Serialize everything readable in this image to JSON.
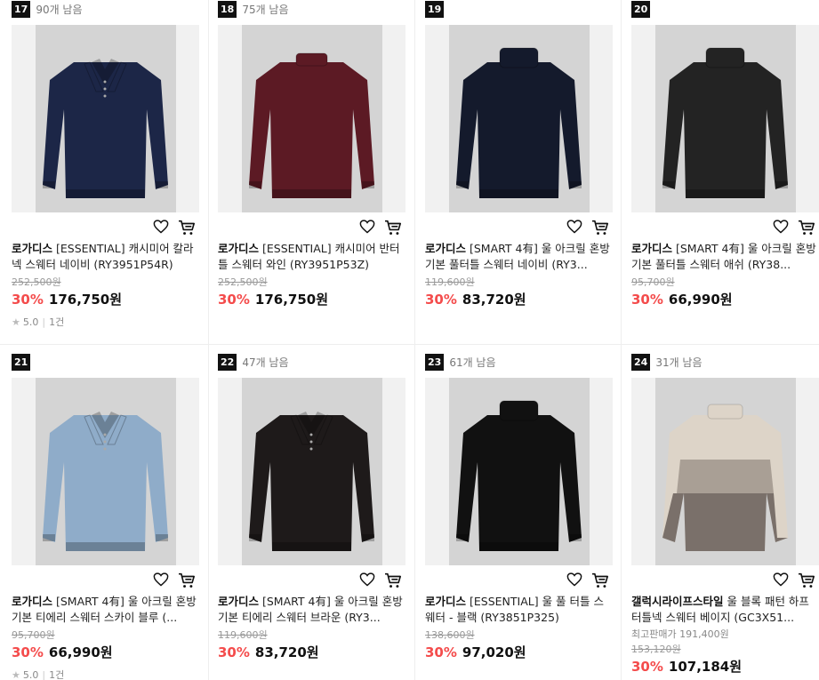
{
  "products": [
    {
      "rank": "17",
      "stock": "90개 남음",
      "brand": "로가디스",
      "name": "[ESSENTIAL] 캐시미어 칼라넥 스웨터 네이비 (RY3951P54R)",
      "original_price": "252,500원",
      "discount": "30%",
      "price": "176,750원",
      "rating": "5.0",
      "reviews": "1건",
      "color": "#1c2647",
      "style": "polo"
    },
    {
      "rank": "18",
      "stock": "75개 남음",
      "brand": "로가디스",
      "name": "[ESSENTIAL] 캐시미어 반터틀 스웨터 와인 (RY3951P53Z)",
      "original_price": "252,500원",
      "discount": "30%",
      "price": "176,750원",
      "color": "#5c1a24",
      "style": "mock"
    },
    {
      "rank": "19",
      "stock": "",
      "brand": "로가디스",
      "name": "[SMART 4有] 울 아크릴 혼방 기본 풀터틀 스웨터 네이비 (RY3...",
      "original_price": "119,600원",
      "discount": "30%",
      "price": "83,720원",
      "color": "#141a2c",
      "style": "turtle"
    },
    {
      "rank": "20",
      "stock": "",
      "brand": "로가디스",
      "name": "[SMART 4有] 울 아크릴 혼방 기본 풀터틀 스웨터 애쉬 (RY38...",
      "original_price": "95,700원",
      "discount": "30%",
      "price": "66,990원",
      "color": "#232323",
      "style": "turtle"
    },
    {
      "rank": "21",
      "stock": "",
      "brand": "로가디스",
      "name": "[SMART 4有] 울 아크릴 혼방 기본 티에리 스웨터 스카이 블루 (...",
      "original_price": "95,700원",
      "discount": "30%",
      "price": "66,990원",
      "rating": "5.0",
      "reviews": "1건",
      "color": "#8facc9",
      "style": "polo"
    },
    {
      "rank": "22",
      "stock": "47개 남음",
      "brand": "로가디스",
      "name": "[SMART 4有] 울 아크릴 혼방 기본 티에리 스웨터 브라운 (RY3...",
      "original_price": "119,600원",
      "discount": "30%",
      "price": "83,720원",
      "color": "#1e1a1a",
      "style": "polo"
    },
    {
      "rank": "23",
      "stock": "61개 남음",
      "brand": "로가디스",
      "name": "[ESSENTIAL] 울 풀 터틀 스웨터 - 블랙 (RY3851P325)",
      "original_price": "138,600원",
      "discount": "30%",
      "price": "97,020원",
      "color": "#111111",
      "style": "turtle"
    },
    {
      "rank": "24",
      "stock": "31개 남음",
      "brand": "갤럭시라이프스타일",
      "name": "울 블록 패턴 하프 터틀넥 스웨터 베이지 (GC3X51...",
      "best_price": "최고판매가 191,400원",
      "original_price": "153,120원",
      "discount": "30%",
      "price": "107,184원",
      "color": "#b8afa3",
      "style": "block"
    }
  ],
  "icons": {
    "wishlist": "heart-icon",
    "cart": "cart-icon",
    "star": "star-icon"
  },
  "colors": {
    "discount": "#f44c4c",
    "rank_badge": "#111111"
  }
}
